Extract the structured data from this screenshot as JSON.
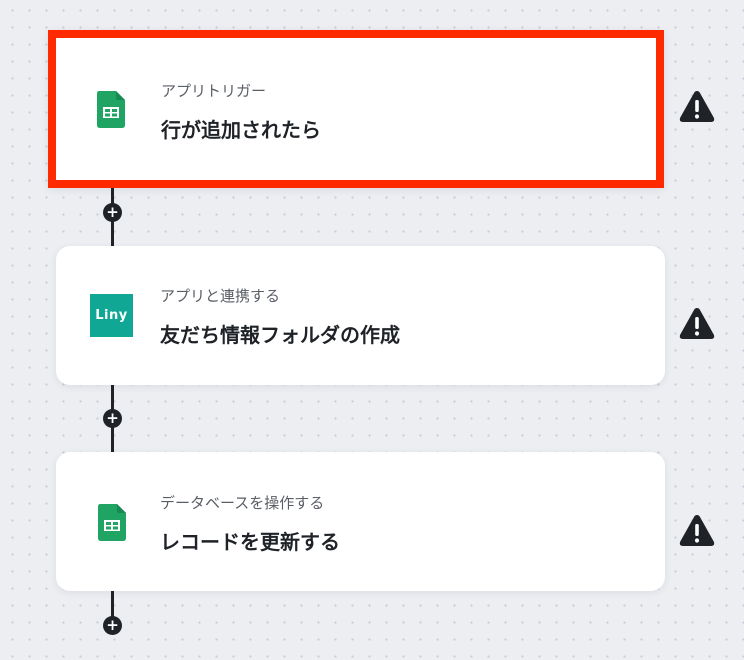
{
  "steps": [
    {
      "subtitle": "アプリトリガー",
      "title": "行が追加されたら",
      "app_icon": "google-sheets-icon",
      "selected": true
    },
    {
      "subtitle": "アプリと連携する",
      "title": "友だち情報フォルダの作成",
      "app_icon": "liny-icon",
      "logo_text": "Liny",
      "selected": false
    },
    {
      "subtitle": "データベースを操作する",
      "title": "レコードを更新する",
      "app_icon": "google-sheets-icon",
      "selected": false
    }
  ],
  "add_step_symbol": "+",
  "icons": {
    "warning": "warning-triangle-icon"
  },
  "colors": {
    "selection_border": "#ff2a00",
    "connector": "#1f2328",
    "sheets_green": "#1fa463",
    "liny_teal": "#11a795",
    "background": "#eceef2"
  }
}
